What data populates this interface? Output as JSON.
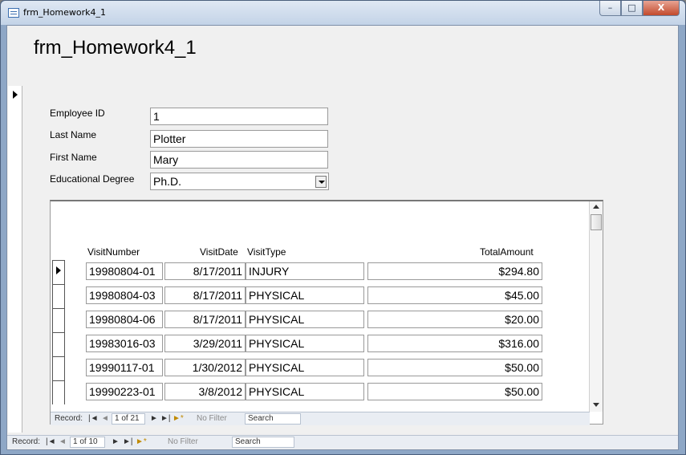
{
  "window": {
    "title": "frm_Homework4_1",
    "minimize": "–",
    "maximize": "□",
    "close": "X"
  },
  "form": {
    "title": "frm_Homework4_1",
    "fields": {
      "employee_id": {
        "label": "Employee ID",
        "value": "1"
      },
      "last_name": {
        "label": "Last Name",
        "value": "Plotter"
      },
      "first_name": {
        "label": "First Name",
        "value": "Mary"
      },
      "degree": {
        "label": "Educational Degree",
        "value": "Ph.D."
      }
    }
  },
  "subform": {
    "columns": {
      "visit_number": "VisitNumber",
      "visit_date": "VisitDate",
      "visit_type": "VisitType",
      "total_amount": "TotalAmount"
    },
    "rows": [
      {
        "visit_number": "19980804-01",
        "visit_date": "8/17/2011",
        "visit_type": "INJURY",
        "total_amount": "$294.80"
      },
      {
        "visit_number": "19980804-03",
        "visit_date": "8/17/2011",
        "visit_type": "PHYSICAL",
        "total_amount": "$45.00"
      },
      {
        "visit_number": "19980804-06",
        "visit_date": "8/17/2011",
        "visit_type": "PHYSICAL",
        "total_amount": "$20.00"
      },
      {
        "visit_number": "19983016-03",
        "visit_date": "3/29/2011",
        "visit_type": "PHYSICAL",
        "total_amount": "$316.00"
      },
      {
        "visit_number": "19990117-01",
        "visit_date": "1/30/2012",
        "visit_type": "PHYSICAL",
        "total_amount": "$50.00"
      },
      {
        "visit_number": "19990223-01",
        "visit_date": "3/8/2012",
        "visit_type": "PHYSICAL",
        "total_amount": "$50.00"
      }
    ],
    "nav": {
      "record_label": "Record:",
      "first": "|◄",
      "prev": "◄",
      "position": "1 of 21",
      "next": "►",
      "last": "►|",
      "new": "►*",
      "filter": "No Filter",
      "search": "Search"
    }
  },
  "main_nav": {
    "record_label": "Record:",
    "first": "|◄",
    "prev": "◄",
    "position": "1 of 10",
    "next": "►",
    "last": "►|",
    "new": "►*",
    "filter": "No Filter",
    "search": "Search"
  }
}
